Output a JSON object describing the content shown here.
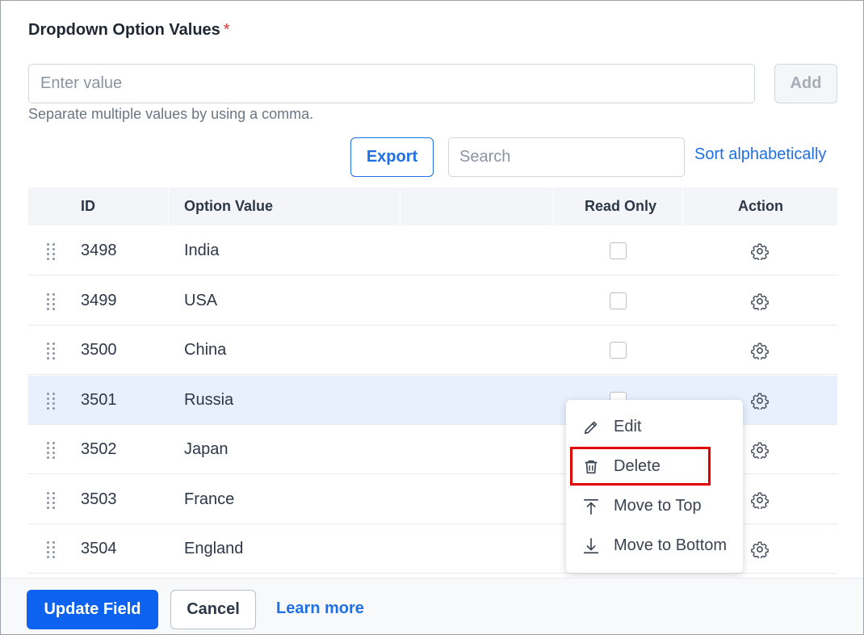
{
  "section": {
    "title": "Dropdown Option Values",
    "required_mark": "*"
  },
  "value_input": {
    "placeholder": "Enter value",
    "value": ""
  },
  "add_label": "Add",
  "hint": "Separate multiple values by using a comma.",
  "toolbar": {
    "export_label": "Export",
    "search_placeholder": "Search",
    "sort_label": "Sort alphabetically"
  },
  "table": {
    "headers": {
      "id": "ID",
      "option_value": "Option Value",
      "read_only": "Read Only",
      "action": "Action"
    },
    "rows": [
      {
        "id": "3498",
        "value": "India",
        "read_only": false
      },
      {
        "id": "3499",
        "value": "USA",
        "read_only": false
      },
      {
        "id": "3500",
        "value": "China",
        "read_only": false
      },
      {
        "id": "3501",
        "value": "Russia",
        "read_only": false,
        "highlighted": true
      },
      {
        "id": "3502",
        "value": "Japan",
        "read_only": false
      },
      {
        "id": "3503",
        "value": "France",
        "read_only": false
      },
      {
        "id": "3504",
        "value": "England",
        "read_only": false
      }
    ]
  },
  "context_menu": {
    "items": [
      {
        "label": "Edit",
        "icon": "pencil-icon"
      },
      {
        "label": "Delete",
        "icon": "trash-icon"
      },
      {
        "label": "Move to Top",
        "icon": "arrow-up-to-line-icon"
      },
      {
        "label": "Move to Bottom",
        "icon": "arrow-down-to-line-icon"
      }
    ]
  },
  "footer": {
    "update_label": "Update Field",
    "cancel_label": "Cancel",
    "learn_more_label": "Learn more"
  },
  "colors": {
    "primary": "#0d63f0",
    "link": "#1f6fe5",
    "highlight_row": "#e8f0fe",
    "annotation": "#e00000",
    "required": "#e03131"
  }
}
